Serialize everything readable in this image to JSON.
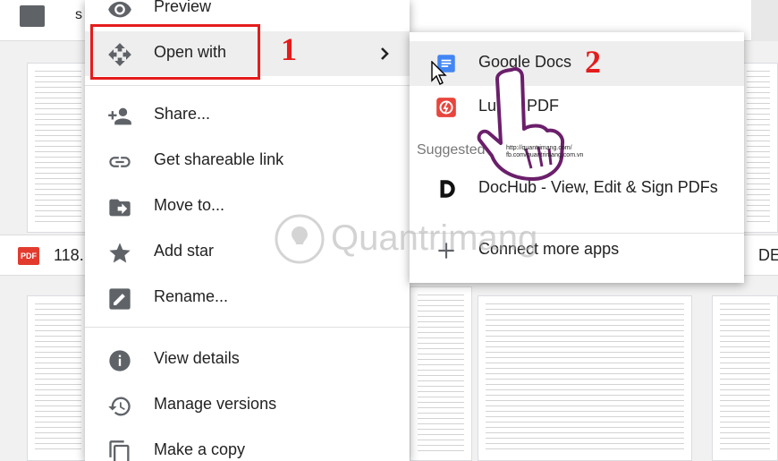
{
  "background": {
    "top_item_partial": "s",
    "file_name_partial": "118.",
    "file_name_right_partial": "DE",
    "pdf_badge": "PDF"
  },
  "menu": {
    "items": [
      {
        "label": "Preview",
        "icon": "eye-icon"
      },
      {
        "label": "Open with",
        "icon": "move-cross-icon",
        "highlighted": true
      },
      {
        "label": "Share...",
        "icon": "add-person-icon"
      },
      {
        "label": "Get shareable link",
        "icon": "link-icon"
      },
      {
        "label": "Move to...",
        "icon": "folder-move-icon"
      },
      {
        "label": "Add star",
        "icon": "star-icon"
      },
      {
        "label": "Rename...",
        "icon": "pencil-icon"
      },
      {
        "label": "View details",
        "icon": "info-icon"
      },
      {
        "label": "Manage versions",
        "icon": "history-icon"
      },
      {
        "label": "Make a copy",
        "icon": "copy-icon"
      }
    ]
  },
  "submenu": {
    "items": [
      {
        "label": "Google Docs",
        "icon": "google-docs-icon",
        "highlighted": true
      },
      {
        "label": "Lumin PDF",
        "icon": "lumin-pdf-icon"
      },
      {
        "label": "DocHub - View, Edit & Sign PDFs",
        "icon": "dochub-icon"
      },
      {
        "label": "Connect more apps",
        "icon": "plus-icon"
      }
    ],
    "heading": "Suggested apps"
  },
  "annotations": {
    "step1": "1",
    "step2": "2",
    "pointer_url_1": "http://quantrimang.com/",
    "pointer_url_2": "fb.com/quantrimang.com.vn"
  },
  "watermark": "Quantrimang",
  "colors": {
    "annotation_red": "#e51c1c",
    "google_docs_blue": "#4285f4",
    "lumin_red": "#e8453c",
    "pointer_purple": "#6b1f6b"
  }
}
